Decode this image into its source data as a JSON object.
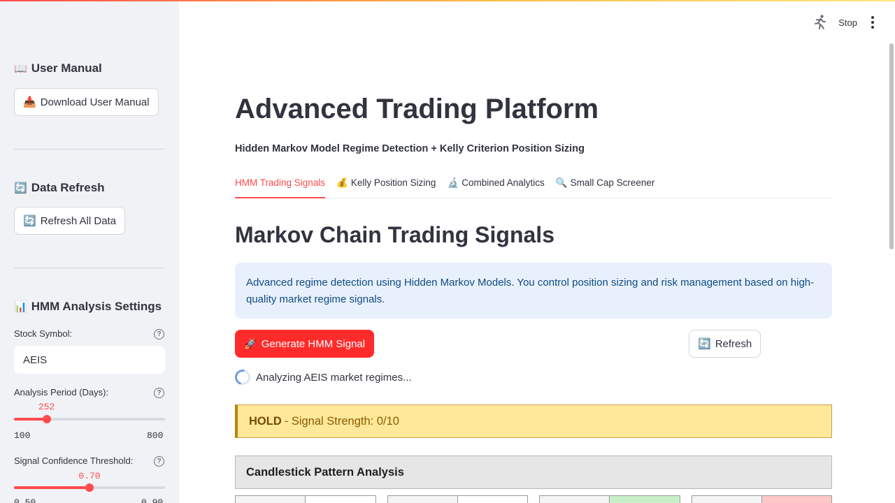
{
  "sidebar": {
    "manual": {
      "icon": "📖",
      "heading": "User Manual",
      "button_icon": "📥",
      "button_label": "Download User Manual"
    },
    "refresh": {
      "icon": "🔄",
      "heading": "Data Refresh",
      "button_icon": "🔄",
      "button_label": "Refresh All Data"
    },
    "settings": {
      "icon": "📊",
      "heading": "HMM Analysis Settings",
      "symbol_label": "Stock Symbol:",
      "symbol_value": "AEIS",
      "period": {
        "label": "Analysis Period (Days):",
        "value": "252",
        "min": "100",
        "max": "800",
        "fraction": 0.216
      },
      "confidence": {
        "label": "Signal Confidence Threshold:",
        "value": "0.70",
        "min": "0.50",
        "max": "0.90",
        "fraction": 0.5
      }
    }
  },
  "header": {
    "stop_label": "Stop"
  },
  "main": {
    "title": "Advanced Trading Platform",
    "subtitle": "Hidden Markov Model Regime Detection + Kelly Criterion Position Sizing",
    "tabs": [
      {
        "icon": "",
        "label": "HMM Trading Signals"
      },
      {
        "icon": "💰",
        "label": "Kelly Position Sizing"
      },
      {
        "icon": "🔬",
        "label": "Combined Analytics"
      },
      {
        "icon": "🔍",
        "label": "Small Cap Screener"
      }
    ],
    "section_title": "Markov Chain Trading Signals",
    "info_text": "Advanced regime detection using Hidden Markov Models. You control position sizing and risk management based on high-quality market regime signals.",
    "generate_icon": "🚀",
    "generate_label": "Generate HMM Signal",
    "refresh_icon": "🔄",
    "refresh_label": "Refresh",
    "spinner_text": "Analyzing AEIS market regimes...",
    "signal_label": "HOLD",
    "signal_detail": "- Signal Strength: 0/10",
    "pattern_title": "Candlestick Pattern Analysis"
  },
  "colors": {
    "accent": "#ff4b4b",
    "info_bg": "#e8f1fb",
    "warning_bg": "#ffe89a",
    "bullish": "#c8f0c8",
    "bearish": "#ffc8c8"
  }
}
